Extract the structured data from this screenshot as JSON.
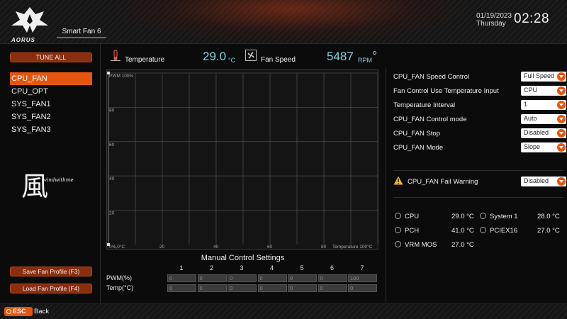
{
  "header": {
    "brand": "AORUS",
    "page_title": "Smart Fan 6",
    "date": "01/19/2023",
    "day": "Thursday",
    "time": "02:28"
  },
  "sidebar": {
    "tune_all_label": "TUNE ALL",
    "fans": [
      "CPU_FAN",
      "CPU_OPT",
      "SYS_FAN1",
      "SYS_FAN2",
      "SYS_FAN3"
    ],
    "selected": "CPU_FAN",
    "watermark_char": "風",
    "watermark_text": "windwithme",
    "save_label": "Save Fan Profile (F3)",
    "load_label": "Load Fan Profile (F4)"
  },
  "readouts": {
    "temperature_label": "Temperature",
    "temperature_value": "29.0",
    "temperature_unit": "°C",
    "fan_speed_label": "Fan Speed",
    "fan_speed_value": "5487",
    "fan_speed_unit": "RPM"
  },
  "graph": {
    "y_ticks": [
      "PWM 100%",
      "80",
      "60",
      "40",
      "20"
    ],
    "x_ticks": [
      "0%,0°C",
      "20",
      "40",
      "60",
      "80",
      "Temperature 100°C"
    ]
  },
  "manual": {
    "title": "Manual Control Settings",
    "columns": [
      "1",
      "2",
      "3",
      "4",
      "5",
      "6",
      "7"
    ],
    "pwm_label": "PWM(%)",
    "temp_label": "Temp(°C)",
    "pwm_values": [
      "0",
      "0",
      "0",
      "0",
      "0",
      "0",
      "100"
    ],
    "temp_values": [
      "0",
      "0",
      "0",
      "0",
      "0",
      "0",
      "0"
    ]
  },
  "settings": {
    "rows": [
      {
        "label": "CPU_FAN Speed Control",
        "value": "Full Speed"
      },
      {
        "label": "Fan Control Use Temperature Input",
        "value": "CPU"
      },
      {
        "label": "Temperature Interval",
        "value": "1"
      },
      {
        "label": "CPU_FAN Control mode",
        "value": "Auto"
      },
      {
        "label": "CPU_FAN Stop",
        "value": "Disabled"
      },
      {
        "label": "CPU_FAN Mode",
        "value": "Slope"
      }
    ],
    "fail_warning_label": "CPU_FAN Fail Warning",
    "fail_warning_value": "Disabled"
  },
  "sensors": [
    {
      "name": "CPU",
      "value": "29.0 °C"
    },
    {
      "name": "System 1",
      "value": "28.0 °C"
    },
    {
      "name": "PCH",
      "value": "41.0 °C"
    },
    {
      "name": "PCIEX16",
      "value": "27.0 °C"
    },
    {
      "name": "VRM MOS",
      "value": "27.0 °C"
    }
  ],
  "footer": {
    "esc_label": "ESC",
    "back_label": "Back"
  },
  "colors": {
    "accent": "#e4560f",
    "value_cyan": "#7fd6e0",
    "button_bg": "#8a2e10"
  }
}
